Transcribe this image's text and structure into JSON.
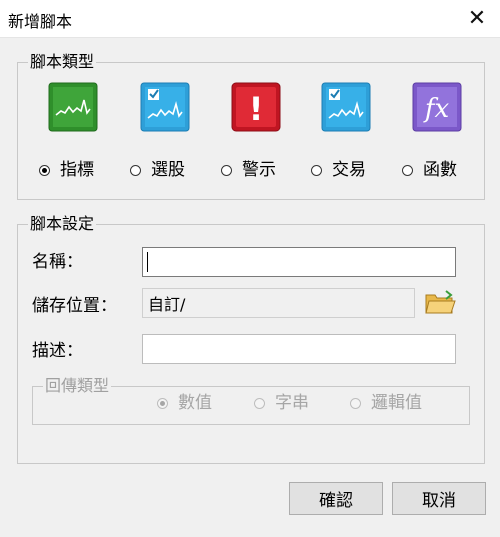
{
  "window": {
    "title": "新增腳本",
    "close_symbol": "✕"
  },
  "script_type": {
    "legend": "腳本類型",
    "options": [
      {
        "label": "指標",
        "icon": "green-line-chart-icon",
        "color": "#3fa53a",
        "checked": true
      },
      {
        "label": "選股",
        "icon": "blue-checked-chart-icon",
        "color": "#2e9fd8",
        "checked": false
      },
      {
        "label": "警示",
        "icon": "red-alert-icon",
        "color": "#d4232f",
        "glyph": "!",
        "checked": false
      },
      {
        "label": "交易",
        "icon": "blue-checked-chart-icon",
        "color": "#2e9fd8",
        "checked": false
      },
      {
        "label": "函數",
        "icon": "purple-fx-icon",
        "color": "#8a68d6",
        "glyph": "fx",
        "checked": false
      }
    ]
  },
  "script_settings": {
    "legend": "腳本設定",
    "name_label": "名稱：",
    "name_value": "",
    "location_label": "儲存位置：",
    "location_value": "自訂/",
    "description_label": "描述：",
    "description_value": ""
  },
  "return_type": {
    "legend": "回傳類型",
    "options": [
      {
        "label": "數值",
        "checked": true
      },
      {
        "label": "字串",
        "checked": false
      },
      {
        "label": "邏輯值",
        "checked": false
      }
    ]
  },
  "buttons": {
    "confirm": "確認",
    "cancel": "取消"
  }
}
